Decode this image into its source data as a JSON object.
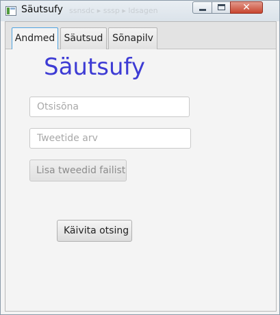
{
  "window": {
    "title": "Säutsufy",
    "background_text": "ssnsdc  ▸ sssp  ▸  ldsagen",
    "close_symbol": "✕"
  },
  "tabs": [
    {
      "label": "Andmed",
      "active": true
    },
    {
      "label": "Säutsud",
      "active": false
    },
    {
      "label": "Sõnapilv",
      "active": false
    }
  ],
  "main": {
    "heading": "Säutsufy",
    "heading_color": "#3d3bd4",
    "keyword_field": {
      "placeholder": "Otsisõna",
      "value": ""
    },
    "tweet_count_field": {
      "placeholder": "Tweetide arv",
      "value": ""
    },
    "load_button": {
      "label": "Lisa tweedid failist",
      "enabled": false
    },
    "search_button": {
      "label": "Käivita otsing",
      "enabled": true
    }
  }
}
